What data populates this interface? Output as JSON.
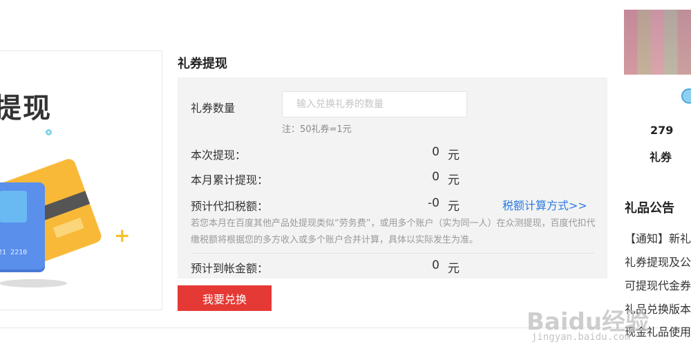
{
  "banner": {
    "title": "提现",
    "card_number": "21 2210"
  },
  "form": {
    "section_title": "礼券提现",
    "quantity": {
      "label": "礼券数量",
      "placeholder": "输入兑换礼券的数量",
      "note": "注：50礼券=1元"
    },
    "current_withdraw": {
      "label": "本次提现：",
      "value": "0",
      "unit": "元"
    },
    "monthly_total": {
      "label": "本月累计提现：",
      "value": "0",
      "unit": "元"
    },
    "estimated_tax": {
      "label": "预计代扣税额：",
      "value": "-0",
      "unit": "元",
      "link": "税额计算方式>>"
    },
    "tax_description": "若您本月在百度其他产品处提现类似“劳务费”，或用多个账户（实为同一人）在众测提现，百度代扣代缴税额将根据您的多方收入或多个账户合并计算，具体以实际发生为准。",
    "estimated_arrival": {
      "label": "预计到帐金额：",
      "value": "0",
      "unit": "元"
    },
    "submit_label": "我要兑换"
  },
  "sidebar": {
    "points_value": "279",
    "points_label": "礼券",
    "notice_title": "礼品公告",
    "notices": [
      "【通知】新礼",
      "礼券提现及公",
      "可提现代金券",
      "礼品兑换版本",
      "现金礼品使用"
    ]
  },
  "watermark": {
    "brand": "Baidu经验",
    "url": "jingyan.baidu.com"
  },
  "colors": {
    "primary_button": "#e53935",
    "link": "#2a7ae2",
    "panel_bg": "#f3f3f3"
  }
}
